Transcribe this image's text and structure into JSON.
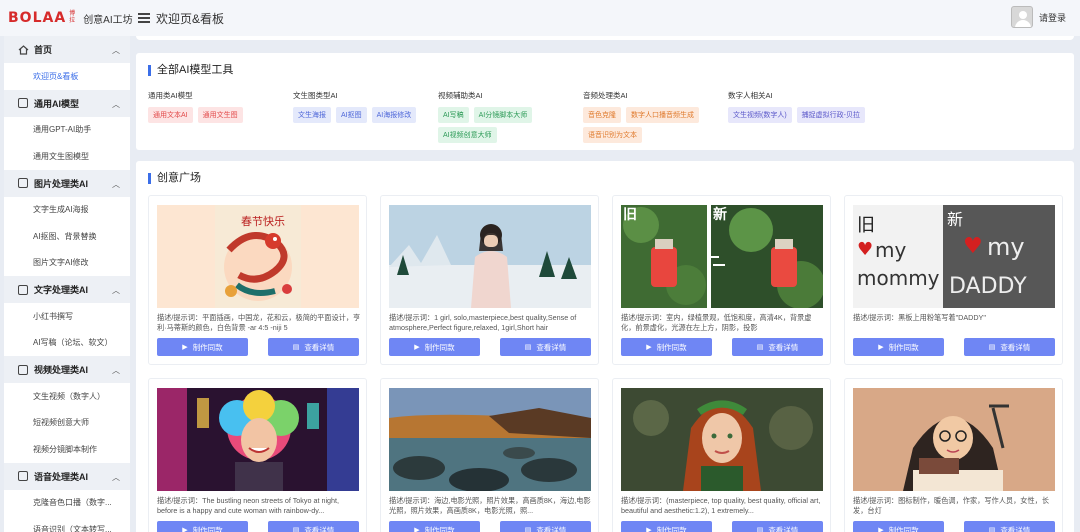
{
  "header": {
    "logo_text": "BOLAA",
    "logo_cn": "博拉",
    "logo_sub": "创意AI工坊",
    "page_title": "欢迎页&看板",
    "login": "请登录"
  },
  "sidebar": {
    "groups": [
      {
        "label": "首页",
        "icon": "home-icon",
        "items": [
          "欢迎页&看板"
        ]
      },
      {
        "label": "通用AI模型",
        "icon": "model-icon",
        "items": [
          "通用GPT-AI助手",
          "通用文生图模型"
        ]
      },
      {
        "label": "图片处理类AI",
        "icon": "image-icon",
        "items": [
          "文字生成AI海报",
          "AI抠图、背景替换",
          "图片文字AI修改"
        ]
      },
      {
        "label": "文字处理类AI",
        "icon": "text-icon",
        "items": [
          "小红书撰写",
          "AI写稿（论坛、软文）"
        ]
      },
      {
        "label": "视频处理类AI",
        "icon": "video-icon",
        "items": [
          "文生视频（数字人）",
          "短视频创意大师",
          "视频分镜脚本制作"
        ]
      },
      {
        "label": "语音处理类AI",
        "icon": "audio-icon",
        "items": [
          "克隆音色口播（数字...",
          "语音识别（文本转写..."
        ]
      }
    ]
  },
  "tools": {
    "title": "全部AI模型工具",
    "columns": [
      {
        "title": "通用类AI模型",
        "tags": [
          {
            "label": "通用文本AI",
            "color": "red"
          },
          {
            "label": "通用文生图",
            "color": "red"
          }
        ]
      },
      {
        "title": "文生图类型AI",
        "tags": [
          {
            "label": "文生海报",
            "color": "blue"
          },
          {
            "label": "AI抠图",
            "color": "blue"
          },
          {
            "label": "AI海报修改",
            "color": "blue"
          }
        ]
      },
      {
        "title": "视频辅助类AI",
        "tags": [
          {
            "label": "AI写稿",
            "color": "green"
          },
          {
            "label": "AI分镜脚本大师",
            "color": "green"
          },
          {
            "label": "AI视频创意大师",
            "color": "green"
          }
        ]
      },
      {
        "title": "音频处理类AI",
        "tags": [
          {
            "label": "音色克隆",
            "color": "orange"
          },
          {
            "label": "数字人口播音频生成",
            "color": "orange"
          },
          {
            "label": "语音识别为文本",
            "color": "orange"
          }
        ]
      },
      {
        "title": "数字人相关AI",
        "tags": [
          {
            "label": "文生视频(数字人)",
            "color": "purple"
          },
          {
            "label": "捕捉虚拟行政-贝拉",
            "color": "purple"
          }
        ]
      }
    ]
  },
  "gallery": {
    "title": "创意广场",
    "make_label": "制作同款",
    "view_label": "查看详情",
    "cards": [
      {
        "desc": "描述/提示词：平面插画，中国龙，花和云，极简的平面设计，亨利·马蒂斯的颜色，白色背景 -ar 4:5 -niji 5",
        "image": "spring-festival-poster"
      },
      {
        "desc": "描述/提示词：1 girl, solo,masterpiece,best quality,Sense of atmosphere,Perfect figure,relaxed, 1girl,Short hair",
        "image": "girl-snow-landscape"
      },
      {
        "desc": "描述/提示词：室内，绿植景观，低饱和度，高清4K，背景虚化，前景虚化，光源在左上方，阴影，投影",
        "image": "perfume-before-after"
      },
      {
        "desc": "描述/提示词：黑板上用粉笔写着\"DADDY\"",
        "image": "chalkboard-before-after"
      },
      {
        "desc": "描述/提示词：The bustling neon streets of Tokyo at night, before is a happy and cute woman with rainbow-dy...",
        "image": "tokyo-neon-woman"
      },
      {
        "desc": "描述/提示词：海边,电影光照，照片效果，高画质8K，海边,电影光照，照片效果，高画质8K，电影光照，照...",
        "image": "seaside-rocks"
      },
      {
        "desc": "描述/提示词：(masterpiece, top quality, best quality, official art, beautiful and aesthetic:1.2), 1 extremely...",
        "image": "redhead-portrait"
      },
      {
        "desc": "描述/提示词：图标制作，暖色调，作家，写作人员，女性，长发，台灯",
        "image": "writer-illustration"
      }
    ]
  },
  "before_after": {
    "old": "旧",
    "new": "新"
  },
  "chalk": {
    "line1": "my",
    "line2": "mommy",
    "line3": "my",
    "line4": "DADDY"
  },
  "poster_text": "春节快乐",
  "colors": {
    "accent": "#3b6ee8",
    "button": "#6f86f4",
    "logo": "#d62b2b"
  }
}
